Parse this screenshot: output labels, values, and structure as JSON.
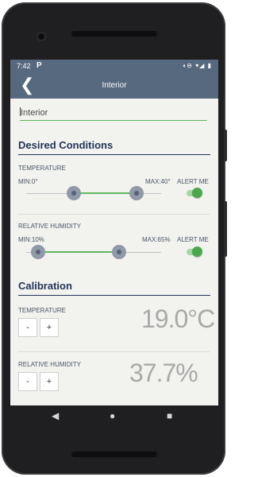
{
  "status": {
    "time": "7:42",
    "app_glyph": "P",
    "sys_icons": "◖⊖ ▾◢ ▮"
  },
  "appbar": {
    "back_glyph": "❮",
    "title": "Interior"
  },
  "name_field": {
    "value": "Interior"
  },
  "desired": {
    "heading": "Desired Conditions",
    "temperature": {
      "label": "TEMPERATURE",
      "min_label": "MIN:0°",
      "max_label": "MAX:40°",
      "alert_label": "ALERT ME",
      "alert_on": true
    },
    "humidity": {
      "label": "RELATIVE HUMIDITY",
      "min_label": "MIN:10%",
      "max_label": "MAX:65%",
      "alert_label": "ALERT ME",
      "alert_on": true
    }
  },
  "calibration": {
    "heading": "Calibration",
    "temperature": {
      "label": "TEMPERATURE",
      "minus": "-",
      "plus": "+",
      "value": "19.0°C"
    },
    "humidity": {
      "label": "RELATIVE HUMIDITY",
      "minus": "-",
      "plus": "+",
      "value": "37.7%"
    }
  },
  "colors": {
    "appbar": "#56697f",
    "accent": "#5cb85c",
    "heading": "#22345a"
  },
  "navbar": {
    "back": "◀",
    "home": "●",
    "recents": "■"
  }
}
